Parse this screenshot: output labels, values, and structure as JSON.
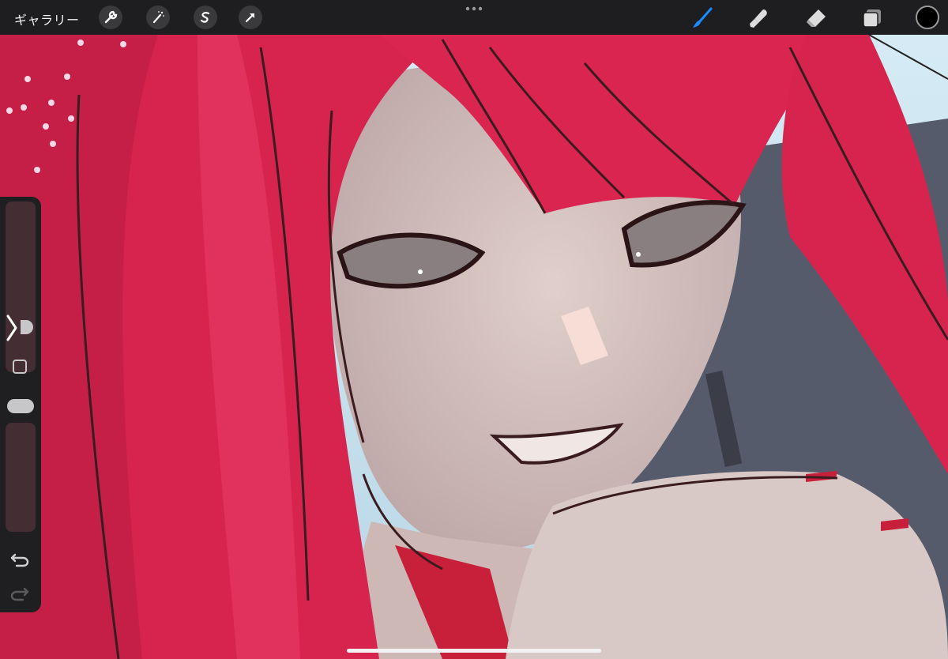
{
  "toolbar": {
    "gallery_label": "ギャラリー",
    "left_tools": [
      "wrench-icon",
      "magic-wand-icon",
      "selection-icon",
      "transform-arrow-icon"
    ],
    "right_tools": [
      "brush-icon",
      "smudge-icon",
      "eraser-icon",
      "layers-icon"
    ],
    "active_tool": "brush-icon",
    "current_color": "#000000",
    "accent_color": "#1a8cff"
  },
  "sidebar": {
    "brush_size_icon": "half-circle-thumb",
    "opacity_icon": "pill-thumb",
    "modify_icon": "square-icon",
    "undo_icon": "undo-icon",
    "redo_icon": "redo-icon",
    "collapse_icon": "chevron-right-icon"
  },
  "canvas": {
    "palette": {
      "hair": "#d6244f",
      "hair_dark": "#b01a3f",
      "skin": "#d9c6c2",
      "skin_shadow": "#b79f9e",
      "sky": "#cfe6f1",
      "coat": "#55596a",
      "line": "#3a1c1f"
    }
  }
}
